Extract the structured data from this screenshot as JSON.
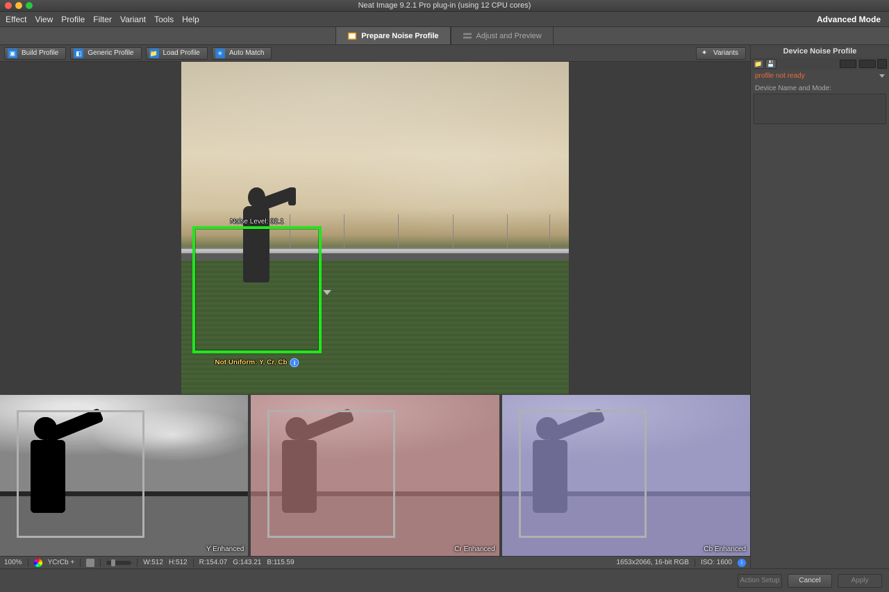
{
  "window": {
    "title": "Neat Image 9.2.1 Pro plug-in (using 12 CPU cores)"
  },
  "menubar": {
    "items": [
      "Effect",
      "View",
      "Profile",
      "Filter",
      "Variant",
      "Tools",
      "Help"
    ],
    "advanced_mode": "Advanced Mode"
  },
  "tabs": {
    "prepare": "Prepare Noise Profile",
    "adjust": "Adjust and Preview"
  },
  "toolbar": {
    "build_profile": "Build Profile",
    "generic_profile": "Generic Profile",
    "load_profile": "Load Profile",
    "auto_match": "Auto Match",
    "variants": "Variants"
  },
  "viewer": {
    "noise_level_label": "Noise Level: 32.1",
    "not_uniform_label": "Not Uniform: Y, Cr, Cb"
  },
  "channels": {
    "y": "Y Enhanced",
    "cr": "Cr Enhanced",
    "cb": "Cb Enhanced"
  },
  "statusbar": {
    "zoom": "100%",
    "mode": "YCrCb +",
    "w_lbl": "W:512",
    "h_lbl": "H:512",
    "r": "R:154.07",
    "g": "G:143.21",
    "b": "B:115.59",
    "dims": "1653x2066, 16-bit RGB",
    "iso": "ISO: 1600"
  },
  "rightpanel": {
    "title": "Device Noise Profile",
    "status": "profile not ready",
    "device_label": "Device Name and Mode:"
  },
  "footer": {
    "action_setup": "Action Setup",
    "cancel": "Cancel",
    "apply": "Apply"
  }
}
